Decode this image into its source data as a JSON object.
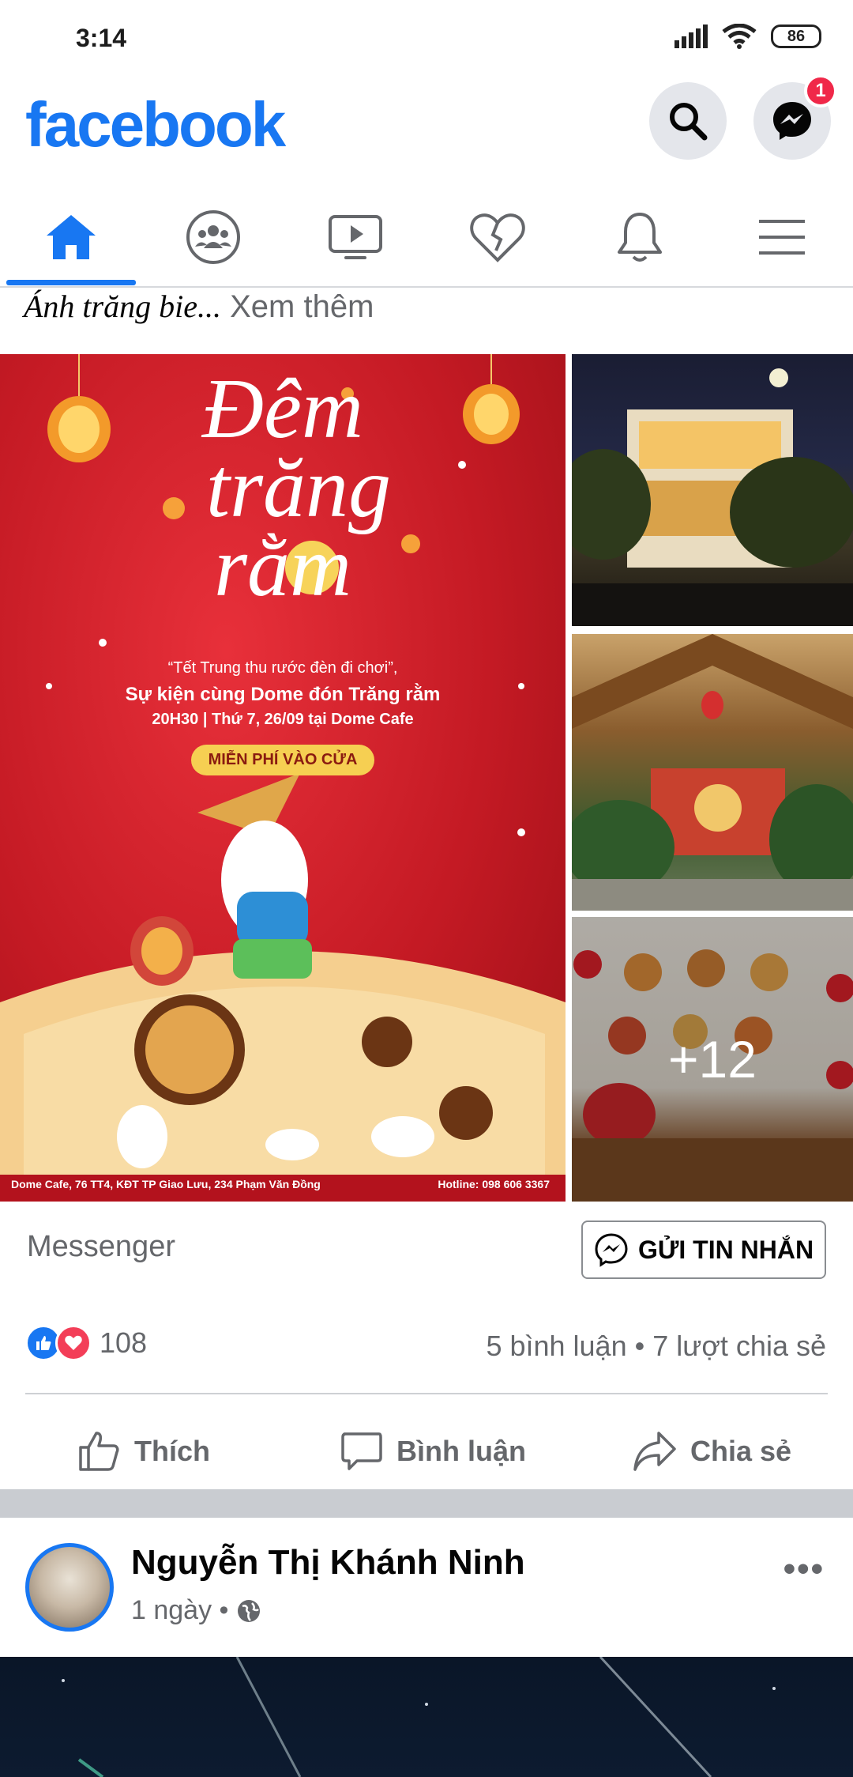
{
  "status": {
    "time": "3:14",
    "battery": "86"
  },
  "header": {
    "logo": "facebook",
    "messenger_badge": "1"
  },
  "tabs": [
    {
      "name": "home",
      "active": true
    },
    {
      "name": "groups"
    },
    {
      "name": "watch"
    },
    {
      "name": "dating"
    },
    {
      "name": "notifications"
    },
    {
      "name": "menu"
    }
  ],
  "post": {
    "text_italic": "Ánh trăng bie",
    "text_ellipsis": "...",
    "see_more": "Xem thêm",
    "poster": {
      "title_line1": "Đêm",
      "title_line2": "trăng",
      "title_line3": "rằm",
      "quote": "“Tết Trung thu rước đèn đi chơi”,",
      "event": "Sự kiện cùng Dome đón Trăng rằm",
      "time": "20H30 | Thứ 7, 26/09 tại Dome Cafe",
      "free": "MIỄN PHÍ VÀO CỬA",
      "address": "Dome Cafe, 76 TT4, KĐT TP Giao Lưu, 234 Phạm Văn Đồng",
      "hotline": "Hotline: 098 606 3367"
    },
    "more_photos": "+12",
    "messenger_label": "Messenger",
    "send_button": "GỬI TIN NHẮN",
    "reaction_count": "108",
    "comments_shares": "5 bình luận • 7 lượt chia sẻ",
    "actions": {
      "like": "Thích",
      "comment": "Bình luận",
      "share": "Chia sẻ"
    }
  },
  "next_post": {
    "author": "Nguyễn Thị Khánh Ninh",
    "time": "1 ngày •"
  },
  "colors": {
    "brand": "#1877f2",
    "badge": "#f02849",
    "secondary_text": "#65676b"
  }
}
